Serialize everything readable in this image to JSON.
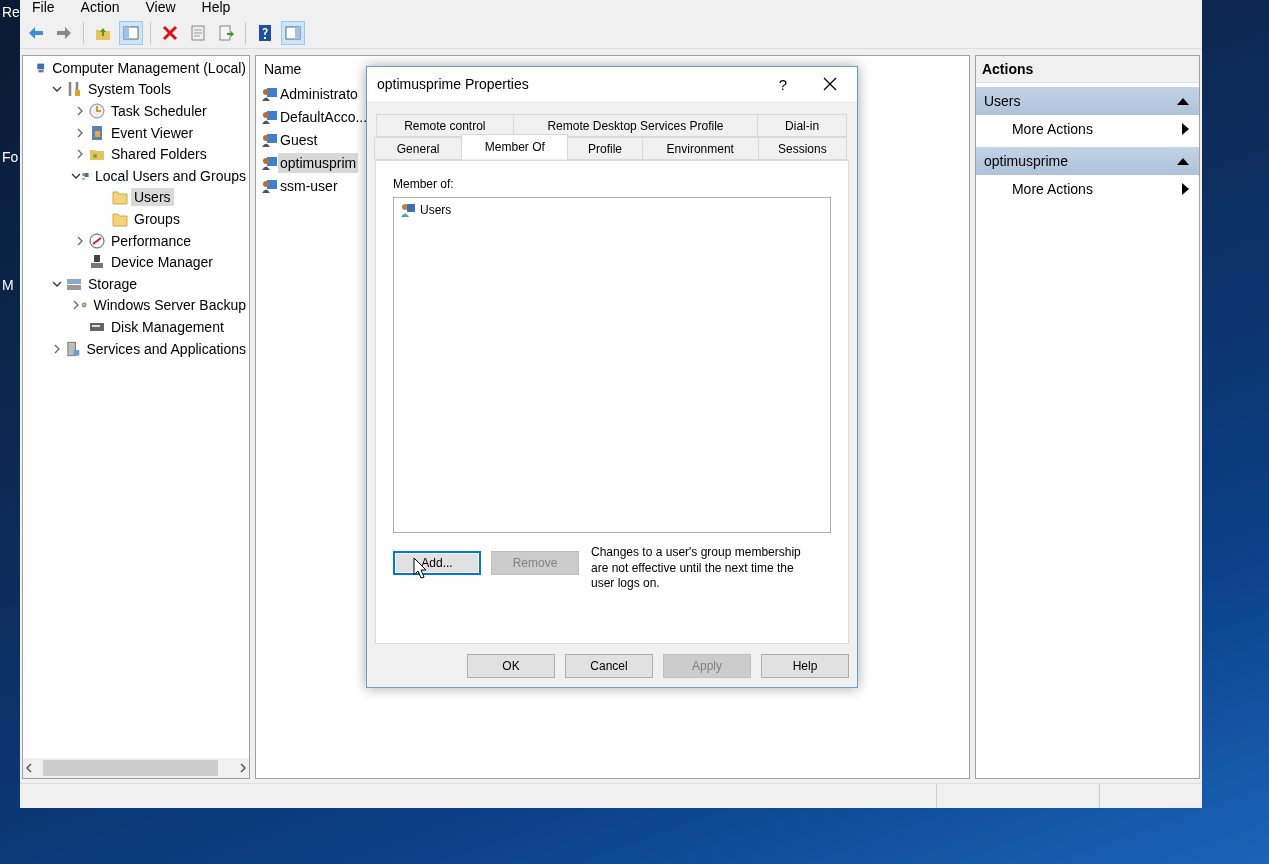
{
  "desktop_icons": [
    {
      "label": "Re"
    },
    {
      "label": "Fo"
    },
    {
      "label": "M"
    }
  ],
  "window": {
    "menu": [
      "File",
      "Action",
      "View",
      "Help"
    ],
    "toolbar": [
      {
        "pressed": false
      },
      {
        "pressed": false
      },
      {
        "pressed": false
      },
      {
        "pressed": true
      },
      {
        "pressed": false
      },
      {
        "pressed": false
      },
      {
        "pressed": false
      },
      {
        "pressed": false
      },
      {
        "pressed": true
      }
    ]
  },
  "tree": [
    {
      "label": "Computer Management (Local)",
      "selected": false,
      "children": [
        {
          "label": "System Tools",
          "expanded": true,
          "selected": false,
          "children": [
            {
              "label": "Task Scheduler",
              "expanded": false,
              "selected": false
            },
            {
              "label": "Event Viewer",
              "expanded": false,
              "selected": false
            },
            {
              "label": "Shared Folders",
              "expanded": false,
              "selected": false
            },
            {
              "label": "Local Users and Groups",
              "expanded": true,
              "selected": false,
              "children": [
                {
                  "label": "Users",
                  "selected": true
                },
                {
                  "label": "Groups",
                  "selected": false
                }
              ]
            },
            {
              "label": "Performance",
              "expanded": false,
              "selected": false
            },
            {
              "label": "Device Manager",
              "selected": false
            }
          ]
        },
        {
          "label": "Storage",
          "expanded": true,
          "selected": false,
          "children": [
            {
              "label": "Windows Server Backup",
              "expanded": false,
              "selected": false
            },
            {
              "label": "Disk Management",
              "selected": false
            }
          ]
        },
        {
          "label": "Services and Applications",
          "expanded": false,
          "selected": false
        }
      ]
    }
  ],
  "list": {
    "columns": [
      "Name"
    ],
    "rows": [
      {
        "name": "Administrato",
        "selected": false
      },
      {
        "name": "DefaultAcco...",
        "selected": false
      },
      {
        "name": "Guest",
        "selected": false
      },
      {
        "name": "optimusprim",
        "selected": true
      },
      {
        "name": "ssm-user",
        "selected": false
      }
    ]
  },
  "actions": {
    "title": "Actions",
    "sections": [
      {
        "title": "Users",
        "expanded": true,
        "items": [
          "More Actions"
        ]
      },
      {
        "title": "optimusprime",
        "expanded": true,
        "items": [
          "More Actions"
        ]
      }
    ]
  },
  "dialog": {
    "title": "optimusprime Properties",
    "help_button": "?",
    "tab_rows": [
      [
        {
          "label": "Remote control",
          "selected": false
        },
        {
          "label": "Remote Desktop Services Profile",
          "selected": false
        },
        {
          "label": "Dial-in",
          "selected": false
        }
      ],
      [
        {
          "label": "General",
          "selected": false
        },
        {
          "label": "Member Of",
          "selected": true
        },
        {
          "label": "Profile",
          "selected": false
        },
        {
          "label": "Environment",
          "selected": false
        },
        {
          "label": "Sessions",
          "selected": false
        }
      ]
    ],
    "member_of_label": "Member of:",
    "members": [
      "Users"
    ],
    "buttons": [
      {
        "label": "Add...",
        "disabled": false,
        "focused": true
      },
      {
        "label": "Remove",
        "disabled": true,
        "focused": false
      }
    ],
    "note": "Changes to a user's group membership are not effective until the next time the user logs on.",
    "footer": [
      {
        "label": "OK",
        "disabled": false
      },
      {
        "label": "Cancel",
        "disabled": false
      },
      {
        "label": "Apply",
        "disabled": true
      },
      {
        "label": "Help",
        "disabled": false
      }
    ]
  }
}
